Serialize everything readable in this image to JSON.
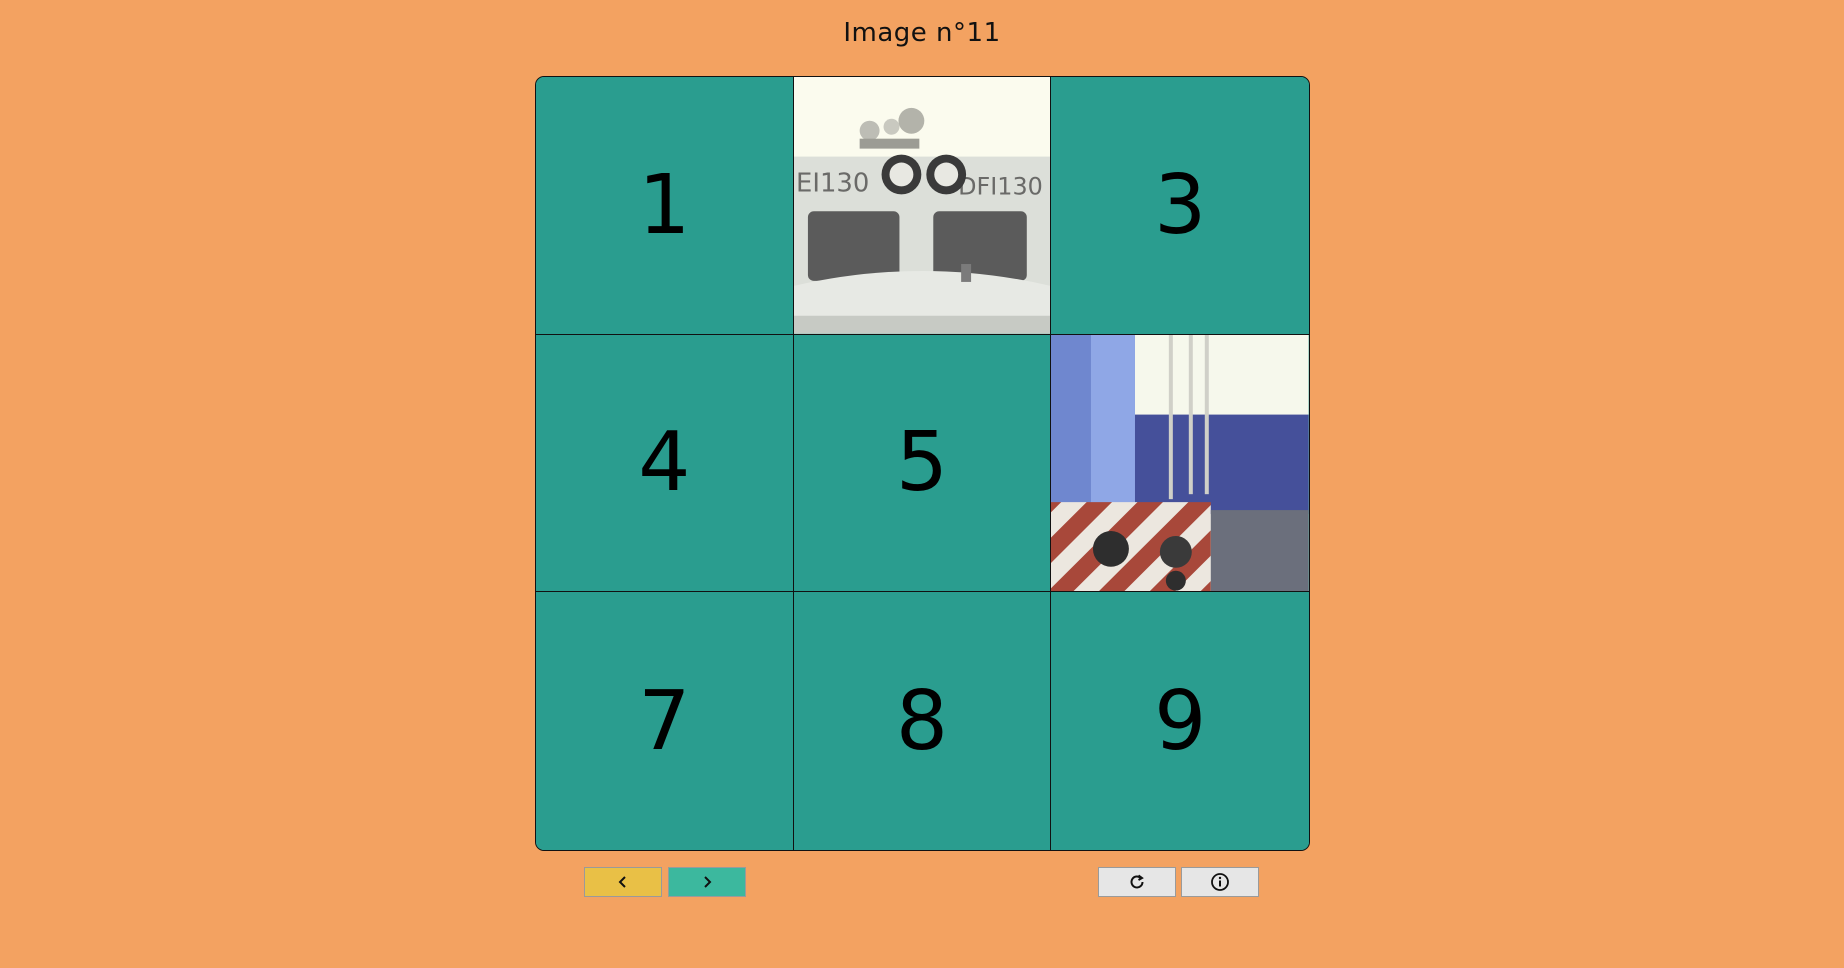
{
  "title": "Image n°11",
  "board": {
    "tiles": [
      {
        "label": "1",
        "photo": false
      },
      {
        "label": "",
        "photo": true,
        "scene": "locomotive-cab-front"
      },
      {
        "label": "3",
        "photo": false
      },
      {
        "label": "4",
        "photo": false
      },
      {
        "label": "5",
        "photo": false
      },
      {
        "label": "",
        "photo": true,
        "scene": "locomotive-side-container"
      },
      {
        "label": "7",
        "photo": false
      },
      {
        "label": "8",
        "photo": false
      },
      {
        "label": "9",
        "photo": false
      }
    ]
  },
  "controls": {
    "prev_icon": "chevron-left-icon",
    "next_icon": "chevron-right-icon",
    "reset_icon": "refresh-icon",
    "info_icon": "info-icon"
  },
  "colors": {
    "background": "#f3a261",
    "tile": "#2a9d8f",
    "prev_button": "#e9c046",
    "next_button": "#3cb89e",
    "utility_button": "#e6e6e6"
  }
}
